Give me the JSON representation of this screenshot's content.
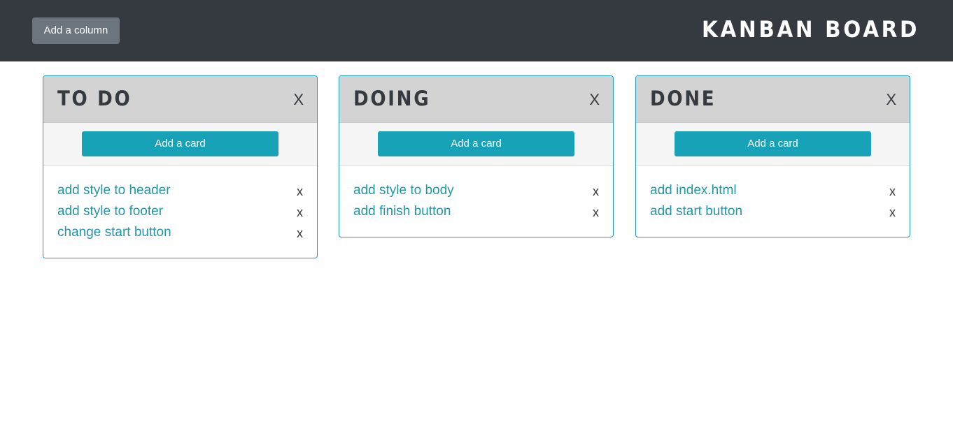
{
  "navbar": {
    "add_column_label": "Add a column",
    "title": "KANBAN BOARD"
  },
  "columns": [
    {
      "title": "TO DO",
      "close_label": "X",
      "add_card_label": "Add a card",
      "cards": [
        {
          "label": "add style to header",
          "close_label": "x"
        },
        {
          "label": "add style to footer",
          "close_label": "x"
        },
        {
          "label": "change start button",
          "close_label": "x"
        }
      ]
    },
    {
      "title": "DOING",
      "close_label": "X",
      "add_card_label": "Add a card",
      "cards": [
        {
          "label": "add style to body",
          "close_label": "x"
        },
        {
          "label": "add finish button",
          "close_label": "x"
        }
      ]
    },
    {
      "title": "DONE",
      "close_label": "X",
      "add_card_label": "Add a card",
      "cards": [
        {
          "label": "add index.html",
          "close_label": "x"
        },
        {
          "label": "add start button",
          "close_label": "x"
        }
      ]
    }
  ],
  "colors": {
    "navbar": "#343a40",
    "accent": "#17a2b8",
    "secondary_button": "#6c757d",
    "column_header": "#d3d3d3",
    "card_text": "#2596a8"
  }
}
